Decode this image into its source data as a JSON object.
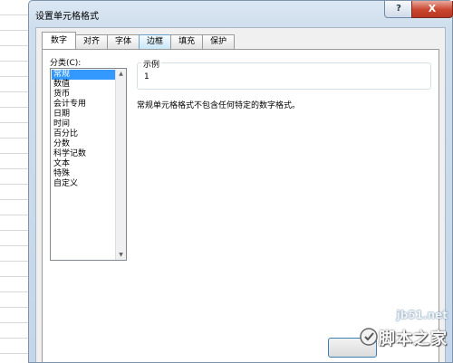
{
  "dialog": {
    "title": "设置单元格格式",
    "help_label": "?",
    "close_label": "X"
  },
  "tabs": [
    {
      "label": "数字",
      "active": true
    },
    {
      "label": "对齐",
      "active": false
    },
    {
      "label": "字体",
      "active": false
    },
    {
      "label": "边框",
      "active": false
    },
    {
      "label": "填充",
      "active": false
    },
    {
      "label": "保护",
      "active": false
    }
  ],
  "category": {
    "label": "分类(C):",
    "items": [
      "常规",
      "数值",
      "货币",
      "会计专用",
      "日期",
      "时间",
      "百分比",
      "分数",
      "科学记数",
      "文本",
      "特殊",
      "自定义"
    ],
    "selected": "常规"
  },
  "sample": {
    "legend": "示例",
    "value": "1"
  },
  "description": "常规单元格格式不包含任何特定的数字格式。",
  "watermark": {
    "url": "jb51.net",
    "text": "脚本之家"
  },
  "colors": {
    "selection": "#3399ff",
    "close_button": "#c9452e"
  }
}
